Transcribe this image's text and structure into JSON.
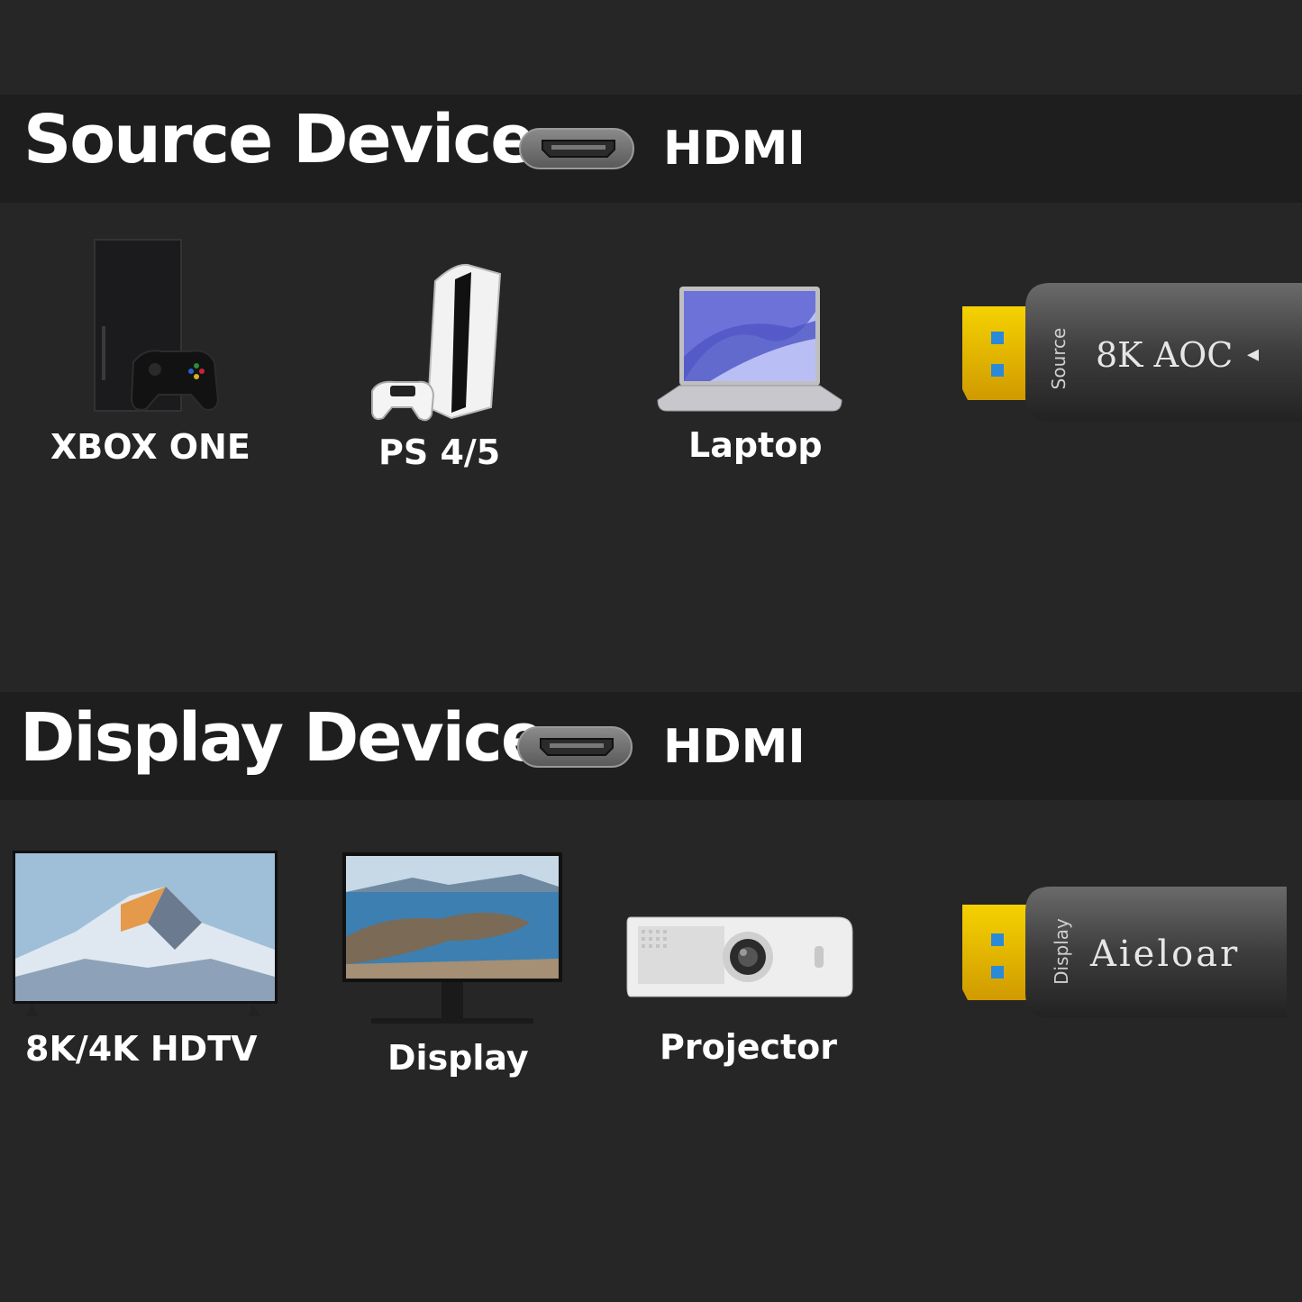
{
  "source": {
    "title": "Source Device",
    "port_label": "HDMI",
    "devices": [
      {
        "label": "XBOX ONE",
        "icon": "xbox-console-icon"
      },
      {
        "label": "PS 4/5",
        "icon": "playstation-console-icon"
      },
      {
        "label": "Laptop",
        "icon": "laptop-icon"
      }
    ],
    "plug": {
      "side_label": "Source",
      "main_label": "8K AOC",
      "arrow": "◂"
    }
  },
  "display": {
    "title": "Display Device",
    "port_label": "HDMI",
    "devices": [
      {
        "label": "8K/4K HDTV",
        "icon": "tv-icon"
      },
      {
        "label": "Display",
        "icon": "monitor-icon"
      },
      {
        "label": "Projector",
        "icon": "projector-icon"
      }
    ],
    "plug": {
      "side_label": "Display",
      "main_label": "Aieloar"
    }
  },
  "colors": {
    "background": "#262626",
    "band": "#1e1e1e",
    "connector_gold": "#e8b800",
    "connector_blue": "#2a8ad8"
  }
}
